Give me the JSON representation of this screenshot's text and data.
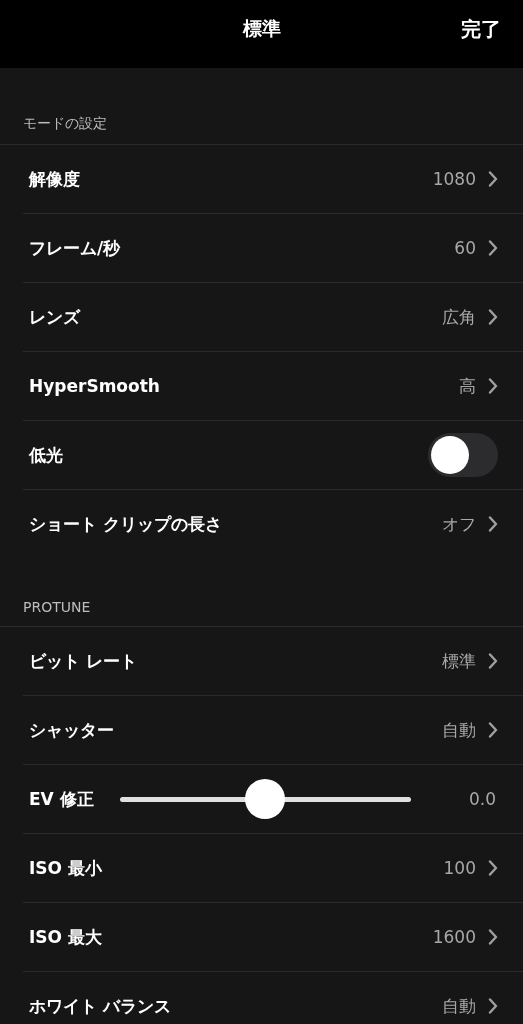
{
  "nav_bar": {
    "title": "標準",
    "done_button": "完了"
  },
  "sections": [
    {
      "header": "モードの設定",
      "rows": [
        {
          "kind": "link",
          "label": "解像度",
          "value": "1080"
        },
        {
          "kind": "link",
          "label": "フレーム/秒",
          "value": "60"
        },
        {
          "kind": "link",
          "label": "レンズ",
          "value": "広角"
        },
        {
          "kind": "link",
          "label": "HyperSmooth",
          "value": "高"
        },
        {
          "kind": "toggle",
          "label": "低光",
          "on": false
        },
        {
          "kind": "link",
          "label": "ショート クリップの長さ",
          "value": "オフ"
        }
      ]
    },
    {
      "header": "PROTUNE",
      "rows": [
        {
          "kind": "link",
          "label": "ビット レート",
          "value": "標準"
        },
        {
          "kind": "link",
          "label": "シャッター",
          "value": "自動"
        },
        {
          "kind": "slider",
          "label": "EV 修正",
          "level": 0.5,
          "reading": "0.0"
        },
        {
          "kind": "link",
          "label": "ISO 最小",
          "value": "100"
        },
        {
          "kind": "link",
          "label": "ISO 最大",
          "value": "1600"
        },
        {
          "kind": "link",
          "label": "ホワイト バランス",
          "value": "自動"
        }
      ]
    }
  ]
}
